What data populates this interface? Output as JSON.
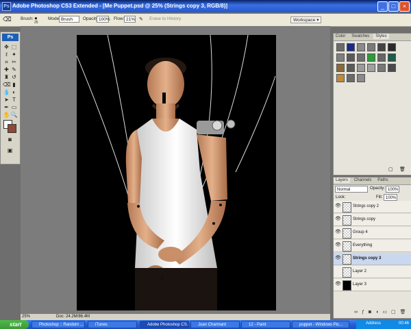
{
  "window": {
    "title": "Adobe Photoshop CS3 Extended - [Me Puppet.psd @ 25% (Strings copy 3, RGB/8)]"
  },
  "options": {
    "brush_label": "Brush:",
    "brush_size": "25",
    "mode_label": "Mode:",
    "mode_value": "Brush",
    "opacity_label": "Opacity:",
    "opacity_value": "100%",
    "flow_label": "Flow:",
    "flow_value": "21%",
    "erase_history": "Erase to History",
    "workspace": "Workspace ▾"
  },
  "toolbox": {
    "logo": "Ps"
  },
  "swatches_panel": {
    "tabs": [
      "Color",
      "Swatches",
      "Styles"
    ],
    "colors": [
      "#6b6b6b",
      "#1a2a8c",
      "#8a8a8a",
      "#7a7a7a",
      "#444444",
      "#2a2a2a",
      "#7f7f7f",
      "#5a5a5a",
      "#6f6f6f",
      "#2e9a3a",
      "#666666",
      "#1f5a4a",
      "#8a6a3a",
      "#5a5a5a",
      "#9a9a9a",
      "#a0a0a0",
      "#777777",
      "#4a4a4a",
      "#c08a3a",
      "#6a6a6a",
      "#8a8a8a"
    ]
  },
  "layers_panel": {
    "tabs": [
      "Layers",
      "Channels",
      "Paths"
    ],
    "blend_mode": "Normal",
    "opacity_label": "Opacity:",
    "opacity_value": "100%",
    "lock_label": "Lock:",
    "fill_label": "Fill:",
    "fill_value": "100%",
    "layers": [
      {
        "name": "Strings copy 2",
        "visible": true,
        "selected": false
      },
      {
        "name": "Strings copy",
        "visible": true,
        "selected": false
      },
      {
        "name": "Group 4",
        "visible": true,
        "selected": false
      },
      {
        "name": "Everything",
        "visible": true,
        "selected": false
      },
      {
        "name": "Strings copy 3",
        "visible": true,
        "selected": true
      },
      {
        "name": "Layer 2",
        "visible": false,
        "selected": false
      },
      {
        "name": "Layer 3",
        "visible": true,
        "selected": false
      }
    ]
  },
  "status": {
    "zoom": "25%",
    "doc": "Doc: 24.2M/86.4M"
  },
  "taskbar": {
    "start": "start",
    "tasks": [
      "Photoshop :: Random ...",
      "iTunes",
      "Adobe Photoshop CS...",
      "Joan Charmant",
      "12 - Paint",
      "puppet - Windows Pic..."
    ],
    "address": "Address",
    "clock": "00:46"
  }
}
